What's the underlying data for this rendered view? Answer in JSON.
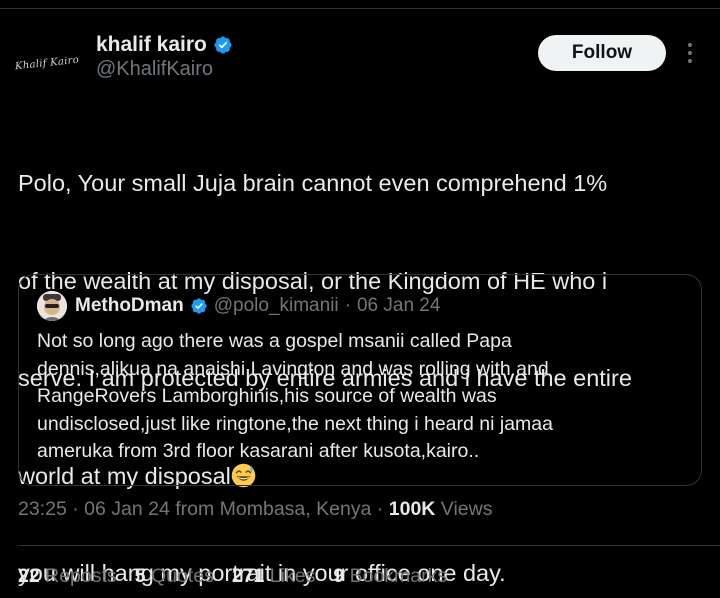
{
  "author": {
    "display_name": "khalif kairo",
    "handle": "@KhalifKairo",
    "avatar_signature": "Khalif Kairo"
  },
  "follow_label": "Follow",
  "tweet_lines": [
    "Polo, Your small Juja brain cannot even comprehend 1%",
    "of the wealth at my disposal, or the Kingdom of HE who i",
    "serve. I am protected by entire armies and i have the entire",
    "world at my disposal",
    "you will hang my portrait in your office one day."
  ],
  "quoted": {
    "display_name": "MethoDman",
    "handle": "@polo_kimanii",
    "separator": "·",
    "date": "06 Jan 24",
    "lines": [
      "Not so long ago there was a gospel msanii called Papa",
      "dennis,alikua na anaishi Lavington and was rolling with and",
      "RangeRovers Lamborghinis,his source of wealth was",
      "undisclosed,just like ringtone,the next thing i heard ni jamaa",
      "ameruka from 3rd floor kasarani after kusota,kairo.."
    ]
  },
  "meta": {
    "time": "23:25",
    "sep1": "·",
    "date_location": "06 Jan 24 from Mombasa, Kenya",
    "sep2": "·",
    "views_count": "100K",
    "views_label": "Views"
  },
  "stats": [
    {
      "count": "22",
      "label": "Reposts"
    },
    {
      "count": "5",
      "label": "Quotes"
    },
    {
      "count": "271",
      "label": "Likes"
    },
    {
      "count": "9",
      "label": "Bookmarks"
    }
  ],
  "colors": {
    "background": "#000000",
    "text": "#e7e9ea",
    "muted": "#71767b",
    "verified": "#1d9bf0",
    "border": "#2f3336"
  }
}
